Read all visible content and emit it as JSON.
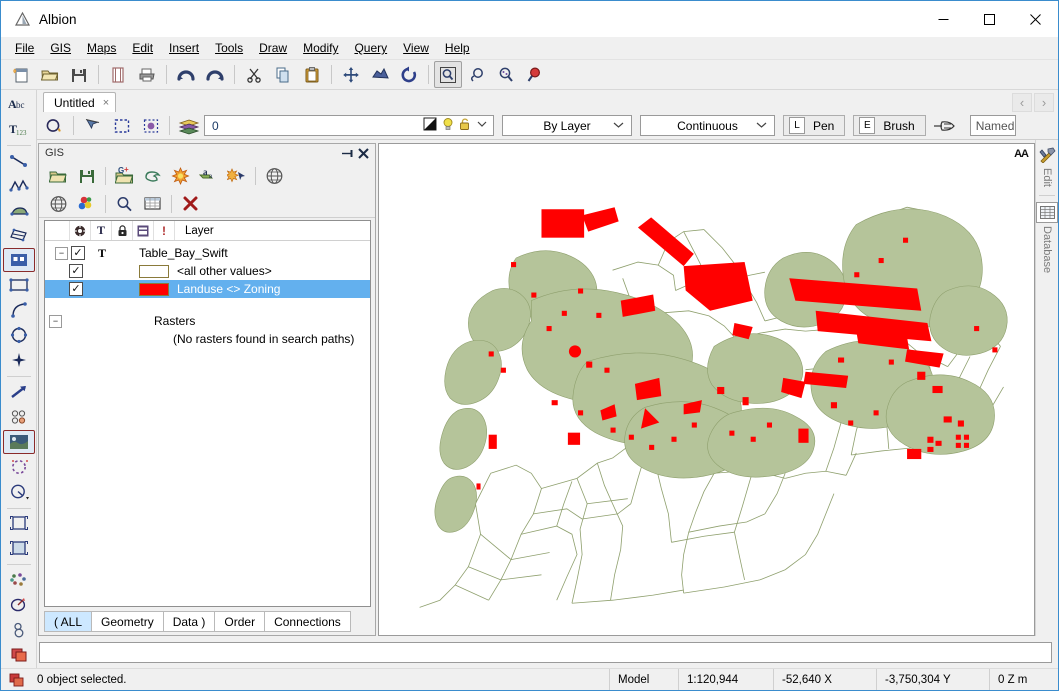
{
  "window": {
    "title": "Albion",
    "app_icon": "albion-triangle-icon",
    "controls": {
      "minimize": "—",
      "maximize": "☐",
      "close": "✕"
    }
  },
  "menubar": {
    "items": [
      {
        "label": "File",
        "mnemonic": "F"
      },
      {
        "label": "GIS",
        "mnemonic": "G"
      },
      {
        "label": "Maps",
        "mnemonic": "M"
      },
      {
        "label": "Edit",
        "mnemonic": "E"
      },
      {
        "label": "Insert",
        "mnemonic": "I"
      },
      {
        "label": "Tools",
        "mnemonic": "T"
      },
      {
        "label": "Draw",
        "mnemonic": "D"
      },
      {
        "label": "Modify",
        "mnemonic": "M"
      },
      {
        "label": "Query",
        "mnemonic": "Q"
      },
      {
        "label": "View",
        "mnemonic": "V"
      },
      {
        "label": "Help",
        "mnemonic": "H"
      }
    ]
  },
  "main_toolbar": {
    "buttons": [
      {
        "name": "new-file-icon"
      },
      {
        "name": "open-folder-icon"
      },
      {
        "name": "save-disk-icon"
      },
      {
        "name": "page-setup-icon"
      },
      {
        "name": "print-icon"
      },
      {
        "name": "undo-icon"
      },
      {
        "name": "redo-icon"
      },
      {
        "name": "cut-scissors-icon"
      },
      {
        "name": "copy-icon"
      },
      {
        "name": "paste-icon"
      },
      {
        "name": "pan-move-icon"
      },
      {
        "name": "zoom-extents-icon"
      },
      {
        "name": "refresh-rotate-icon"
      },
      {
        "name": "zoom-window-icon"
      },
      {
        "name": "zoom-previous-icon"
      },
      {
        "name": "zoom-dynamic-icon"
      },
      {
        "name": "zoom-selected-icon"
      }
    ]
  },
  "document_tabs": {
    "tabs": [
      {
        "label": "Untitled",
        "close": "×",
        "active": true
      }
    ],
    "nav_prev": "‹",
    "nav_next": "›"
  },
  "properties_toolbar": {
    "buttons": [
      {
        "name": "object-properties-icon"
      },
      {
        "name": "select-arrow-icon"
      },
      {
        "name": "selection-window-icon"
      },
      {
        "name": "select-object-icon"
      },
      {
        "name": "layers-stack-icon"
      }
    ],
    "layer_value": "0",
    "layer_icons": [
      {
        "name": "layer-color-icon"
      },
      {
        "name": "lightbulb-visibility-icon"
      },
      {
        "name": "lock-open-icon"
      },
      {
        "name": "chevron-down-icon"
      }
    ],
    "color_combo": "By Layer",
    "linetype_combo": "Continuous",
    "pen": {
      "key": "L",
      "label": "Pen"
    },
    "brush": {
      "key": "E",
      "label": "Brush"
    },
    "pointer_icon": "hand-pointer-icon",
    "named_box": "Named"
  },
  "left_toolbar": {
    "buttons": [
      {
        "name": "text-abc-icon",
        "glyph": "Abc"
      },
      {
        "name": "text-subscript-icon",
        "glyph": "T123"
      },
      {
        "name": "line-tool-icon"
      },
      {
        "name": "polyline-tool-icon"
      },
      {
        "name": "polygon-fill-tool-icon"
      },
      {
        "name": "parallelogram-tool-icon"
      },
      {
        "name": "rectangle-points-tool-icon",
        "pressed": true
      },
      {
        "name": "rectangle-tool-icon"
      },
      {
        "name": "arc-tool-icon"
      },
      {
        "name": "circle-tool-icon"
      },
      {
        "name": "point-tool-icon"
      },
      {
        "name": "arrow-tool-icon"
      },
      {
        "name": "nodes-tool-icon"
      },
      {
        "name": "raster-image-tool-icon",
        "pressed": true
      },
      {
        "name": "select-region-tool-icon"
      },
      {
        "name": "measure-tool-icon"
      },
      {
        "name": "fit-window-tool-icon"
      },
      {
        "name": "zoom-fit-tool-icon"
      },
      {
        "name": "scatter-points-tool-icon"
      },
      {
        "name": "rotate-tool-icon"
      },
      {
        "name": "chain-link-tool-icon"
      },
      {
        "name": "layers-overlap-tool-icon"
      }
    ]
  },
  "gis_panel": {
    "title": "GIS",
    "pin_icon": "pin-icon",
    "close_icon": "close-icon",
    "toolbar_row1": [
      {
        "name": "gis-open-folder-icon"
      },
      {
        "name": "gis-save-icon"
      },
      {
        "name": "gis-open-geoset-icon"
      },
      {
        "name": "gis-select-region-icon"
      },
      {
        "name": "gis-thematic-icon"
      },
      {
        "name": "gis-label-icon"
      },
      {
        "name": "gis-autolabel-icon"
      },
      {
        "name": "gis-projection-globe-icon"
      }
    ],
    "toolbar_row2": [
      {
        "name": "gis-globe-icon"
      },
      {
        "name": "gis-style-palette-icon"
      },
      {
        "name": "gis-find-icon"
      },
      {
        "name": "gis-table-icon"
      },
      {
        "name": "gis-remove-icon"
      }
    ],
    "tree_headers": [
      {
        "name": "visibility-header-icon",
        "glyph": "✲"
      },
      {
        "name": "label-header-icon",
        "glyph": "T"
      },
      {
        "name": "lock-header-icon",
        "glyph": "⚿"
      },
      {
        "name": "table-header-icon",
        "glyph": "▤"
      },
      {
        "name": "alert-header-icon",
        "glyph": "!"
      }
    ],
    "layer_column_label": "Layer",
    "tree": [
      {
        "name": "Table_Bay_Swift",
        "checked": true,
        "expanded": true,
        "has_label_icon": true,
        "children": [
          {
            "name": "<all other values>",
            "checked": true,
            "swatch": "#ffffff",
            "selected": false
          },
          {
            "name": "Landuse <> Zoning",
            "checked": true,
            "swatch": "#ff0000",
            "selected": true
          }
        ]
      }
    ],
    "rasters_group": {
      "label": "Rasters",
      "expanded": true,
      "empty_message": "(No rasters found in search paths)"
    },
    "bottom_tabs": [
      {
        "label": "( ALL",
        "active": true
      },
      {
        "label": "Geometry",
        "active": false
      },
      {
        "label": "Data )",
        "active": false
      },
      {
        "label": "Order",
        "active": false
      },
      {
        "label": "Connections",
        "active": false
      }
    ]
  },
  "map": {
    "antialias_badge": "AA",
    "fill_color": "#b5c49a",
    "stroke_color": "#8fa06e",
    "highlight_color": "#ff0000",
    "background": "#ffffff"
  },
  "right_dock": {
    "items": [
      {
        "label": "Edit",
        "icon": "hammer-wrench-icon"
      },
      {
        "label": "Database",
        "icon": "database-table-icon"
      }
    ]
  },
  "command_line": {
    "value": ""
  },
  "status_bar": {
    "icon": "layers-overlap-icon",
    "message": "0 object selected.",
    "mode": "Model",
    "scale": "1:120,944",
    "x": "-52,640  X",
    "y": "-3,750,304  Y",
    "z": "0  Z  m"
  }
}
